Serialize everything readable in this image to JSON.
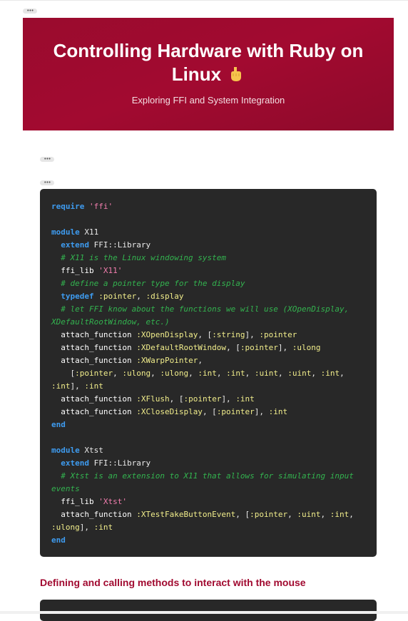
{
  "hero": {
    "title": "Controlling Hardware with Ruby on Linux",
    "subtitle": "Exploring FFI and System Integration",
    "emoji_icon": "pointing-down-hand-icon",
    "background": "#a00a30"
  },
  "menus": {
    "icon": "more-dots-icon",
    "glyph": "•••"
  },
  "code1": {
    "l1_kw": "require",
    "l1_str": "'ffi'",
    "l3_kw": "module",
    "l3_name": "X11",
    "l4_kw": "extend",
    "l4_name": "FFI::Library",
    "l5_cm": "# X11 is the Linux windowing system",
    "l6_fn": "ffi_lib",
    "l6_str": "'X11'",
    "l7_cm": "# define a pointer type for the display",
    "l8_kw": "typedef",
    "l8_a": ":pointer",
    "l8_sep": ", ",
    "l8_b": ":display",
    "l9_cm": "# let FFI know about the functions we will use (XOpenDisplay, XDefaultRootWindow, etc.)",
    "f1_fn": "attach_function",
    "f1_name": ":XOpenDisplay",
    "f1_args": ", [",
    "f1_t1": ":string",
    "f1_close": "], ",
    "f1_ret": ":pointer",
    "f2_fn": "attach_function",
    "f2_name": ":XDefaultRootWindow",
    "f2_args": ", [",
    "f2_t1": ":pointer",
    "f2_close": "], ",
    "f2_ret": ":ulong",
    "f3_fn": "attach_function",
    "f3_name": ":XWarpPointer",
    "f3_comma": ",",
    "f3b_open": "[",
    "f3b_t1": ":pointer",
    "f3b_t2": ":ulong",
    "f3b_t3": ":ulong",
    "f3b_t4": ":int",
    "f3b_t5": ":int",
    "f3b_t6": ":uint",
    "f3b_t7": ":uint",
    "f3b_t8": ":int",
    "f3b_t9": ":int",
    "f3b_close": "], ",
    "f3b_ret": ":int",
    "f4_fn": "attach_function",
    "f4_name": ":XFlush",
    "f4_args": ", [",
    "f4_t1": ":pointer",
    "f4_close": "], ",
    "f4_ret": ":int",
    "f5_fn": "attach_function",
    "f5_name": ":XCloseDisplay",
    "f5_args": ", [",
    "f5_t1": ":pointer",
    "f5_close": "], ",
    "f5_ret": ":int",
    "end1": "end",
    "m2_kw": "module",
    "m2_name": "Xtst",
    "m2_ext_kw": "extend",
    "m2_ext_name": "FFI::Library",
    "m2_cm": "# Xtst is an extension to X11 that allows for simulating input events",
    "m2_fn": "ffi_lib",
    "m2_str": "'Xtst'",
    "m2_af": "attach_function",
    "m2_af_name": ":XTestFakeButtonEvent",
    "m2_af_args": ", [",
    "m2_t1": ":pointer",
    "m2_t2": ":uint",
    "m2_t3": ":int",
    "m2_t4": ":ulong",
    "m2_close": "], ",
    "m2_ret": ":int",
    "end2": "end"
  },
  "section": {
    "heading": "Defining and calling methods to interact with the mouse"
  }
}
